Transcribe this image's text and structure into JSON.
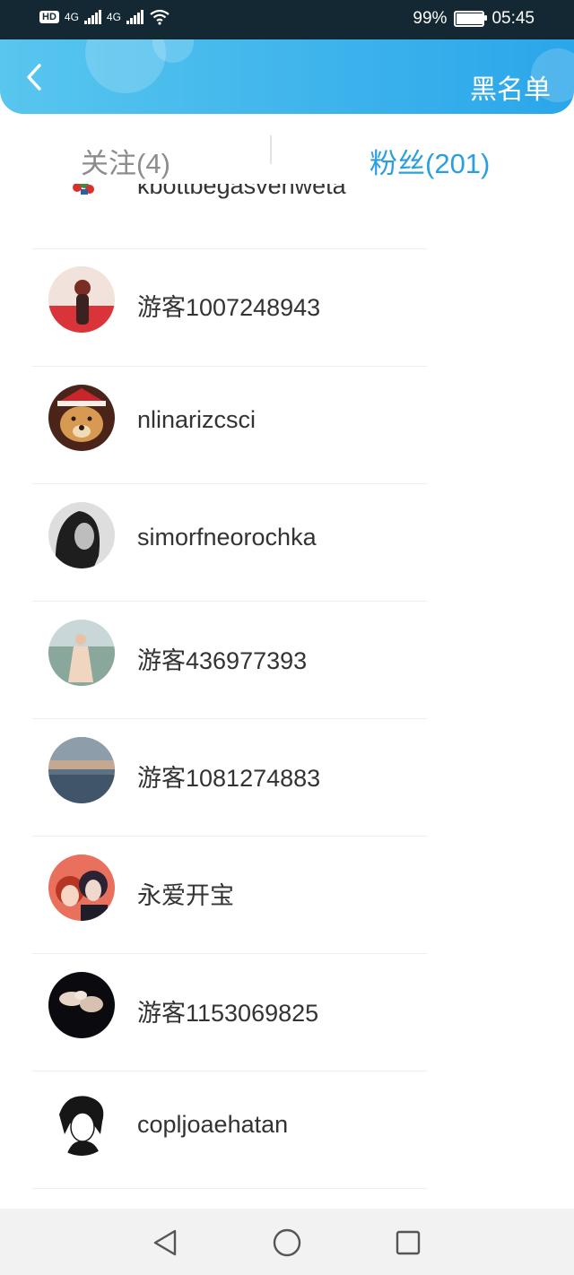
{
  "status_bar": {
    "network": "HD",
    "sim1": "4G",
    "sim2": "4G",
    "battery": "99%",
    "battery_level": 0.99,
    "time": "05:45",
    "icons": [
      "hd-icon",
      "signal-icon",
      "signal-icon",
      "wifi-icon",
      "battery-icon"
    ]
  },
  "header": {
    "back_icon": "chevron-left-icon",
    "blacklist_label": "黑名单",
    "colors": {
      "start": "#58c6ee",
      "end": "#2aa6ea"
    }
  },
  "tabs": {
    "following": "关注(4)",
    "fans": "粉丝(201)",
    "active": "fans",
    "active_color": "#2a9fe0"
  },
  "fans_list": {
    "partial_top": "kbottbegasvenweta",
    "items": [
      {
        "name": "游客1007248943",
        "avatar": "avatar-woman-red"
      },
      {
        "name": "nlinarizcsci",
        "avatar": "avatar-dog-santa-hat"
      },
      {
        "name": "simorfneorochka",
        "avatar": "avatar-dark-hair-bw"
      },
      {
        "name": "游客436977393",
        "avatar": "avatar-woman-dress-stairs"
      },
      {
        "name": "游客1081274883",
        "avatar": "avatar-sky-landscape"
      },
      {
        "name": "永爱开宝",
        "avatar": "avatar-anime-couple"
      },
      {
        "name": "游客1153069825",
        "avatar": "avatar-seashells-dark"
      },
      {
        "name": "copljoaehatan",
        "avatar": "avatar-sketch-girl"
      }
    ]
  },
  "nav_bar": {
    "buttons": [
      "back-triangle-icon",
      "home-circle-icon",
      "recents-square-icon"
    ]
  }
}
